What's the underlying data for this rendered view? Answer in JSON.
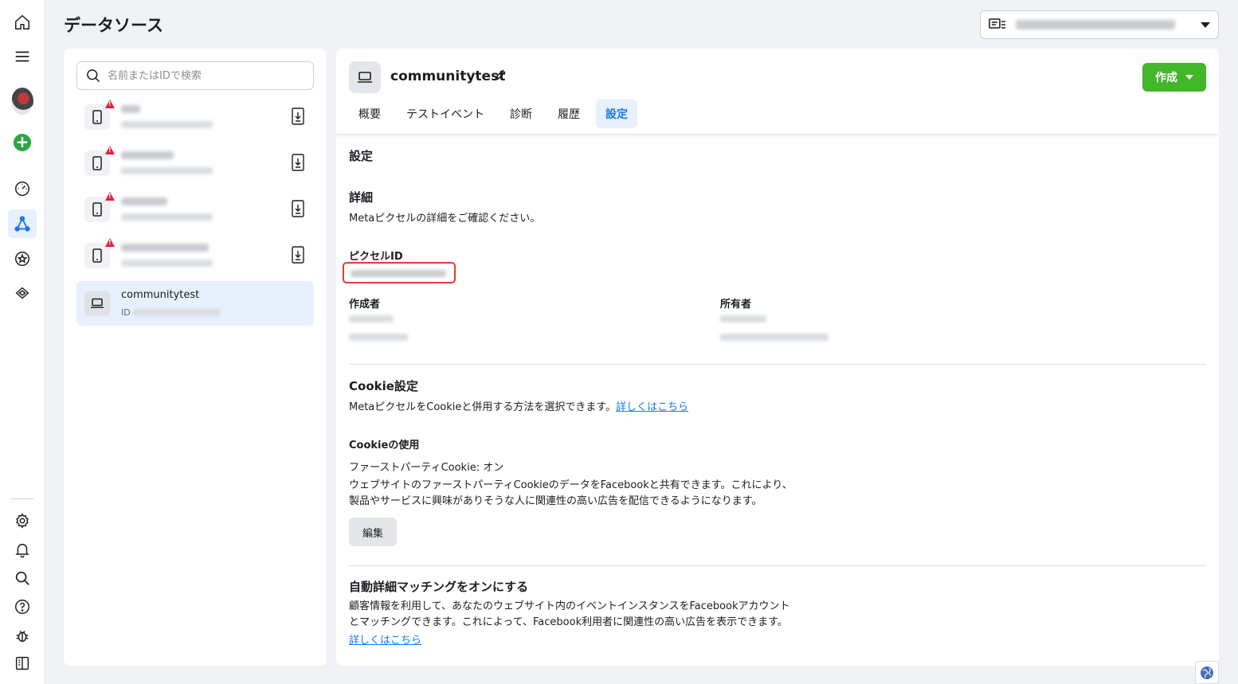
{
  "header": {
    "title": "データソース"
  },
  "sidebar": {
    "search_placeholder": "名前またはIDで検索",
    "selected": {
      "name": "communitytest",
      "id_label": "ID"
    }
  },
  "detail": {
    "pixel_name": "communitytest",
    "create_label": "作成",
    "tabs": [
      {
        "label": "概要"
      },
      {
        "label": "テストイベント"
      },
      {
        "label": "診断"
      },
      {
        "label": "履歴"
      },
      {
        "label": "設定"
      }
    ],
    "settings_heading": "設定",
    "details_heading": "詳細",
    "details_text": "Metaピクセルの詳細をご確認ください。",
    "pixel_id_label": "ピクセルID",
    "creator_label": "作成者",
    "owner_label": "所有者",
    "cookie_heading": "Cookie設定",
    "cookie_text": "MetaピクセルをCookieと併用する方法を選択できます。",
    "learn_more": "詳しくはこちら",
    "cookie_use_heading": "Cookieの使用",
    "first_party_status": "ファーストパーティCookie: オン",
    "first_party_desc_1": "ウェブサイトのファーストパーティCookieのデータをFacebookと共有できます。これにより、",
    "first_party_desc_2": "製品やサービスに興味がありそうな人に関連性の高い広告を配信できるようになります。",
    "edit_label": "編集",
    "auto_heading": "自動詳細マッチングをオンにする",
    "auto_desc_1": "顧客情報を利用して、あなたのウェブサイト内のイベントインスタンスをFacebookアカウント",
    "auto_desc_2": "とマッチングできます。これによって、Facebook利用者に関連性の高い広告を表示できます。",
    "auto_learn_more": "詳しくはこちら"
  },
  "colors": {
    "accent": "#1877f2",
    "create_button": "#42b72a",
    "warning": "#e41e3f",
    "highlight_box": "#e53935"
  }
}
